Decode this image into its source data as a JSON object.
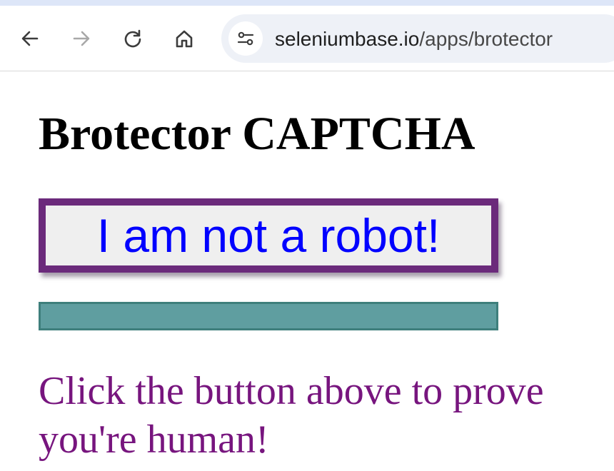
{
  "browser": {
    "url_domain": "seleniumbase.io",
    "url_path": "/apps/brotector",
    "icons": [
      "back-arrow-icon",
      "forward-arrow-icon",
      "reload-icon",
      "home-icon",
      "site-settings-icon"
    ]
  },
  "page": {
    "title": "Brotector CAPTCHA",
    "button_label": "I am not a robot!",
    "instruction": "Click the button above to prove you're human!"
  },
  "colors": {
    "button_border": "#6b2a7b",
    "button_text": "#0000ff",
    "bar_fill": "#5f9ea0",
    "instruction_text": "#77157e"
  }
}
